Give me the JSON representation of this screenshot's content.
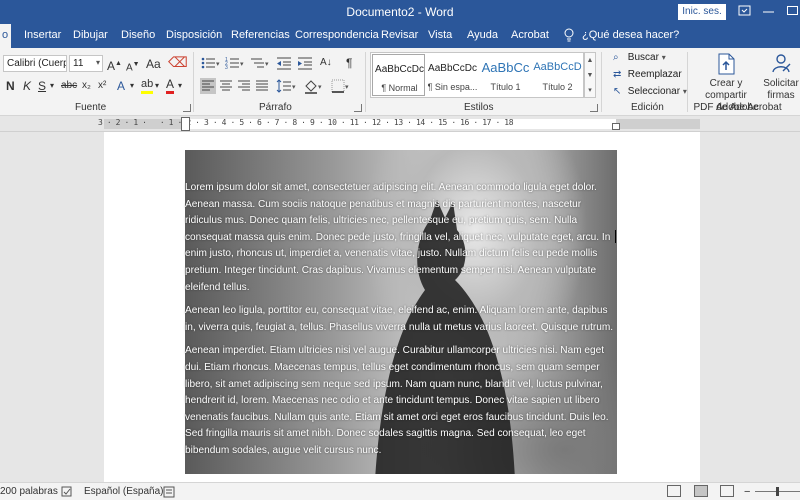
{
  "window": {
    "title": "Documento2 - Word",
    "signin_label": "Inic. ses."
  },
  "tabs": [
    {
      "label": "o",
      "active": true
    },
    {
      "label": "Insertar"
    },
    {
      "label": "Dibujar"
    },
    {
      "label": "Diseño"
    },
    {
      "label": "Disposición"
    },
    {
      "label": "Referencias"
    },
    {
      "label": "Correspondencia"
    },
    {
      "label": "Revisar"
    },
    {
      "label": "Vista"
    },
    {
      "label": "Ayuda"
    },
    {
      "label": "Acrobat"
    }
  ],
  "tellme": {
    "label": "¿Qué desea hacer?"
  },
  "ribbon": {
    "font": {
      "group_label": "Fuente",
      "font_name": "Calibri (Cuerpo",
      "font_size": "11",
      "grow_label": "A",
      "shrink_label": "A",
      "case_label": "Aa",
      "bold": "N",
      "italic": "K",
      "underline": "S",
      "strike": "abc",
      "subscript": "x₂",
      "superscript": "x²",
      "effects": "A",
      "highlight": "ab",
      "fontcolor": "A"
    },
    "paragraph": {
      "group_label": "Párrafo",
      "pilcrow": "¶"
    },
    "styles": {
      "group_label": "Estilos",
      "items": [
        {
          "preview": "AaBbCcDc",
          "name": "¶ Normal"
        },
        {
          "preview": "AaBbCcDc",
          "name": "¶ Sin espa..."
        },
        {
          "preview": "AaBbCc",
          "name": "Título 1"
        },
        {
          "preview": "AaBbCcD",
          "name": "Título 2"
        }
      ]
    },
    "editing": {
      "group_label": "Edición",
      "find": "Buscar",
      "replace": "Reemplazar",
      "select": "Seleccionar"
    },
    "acrobat": {
      "group_label": "Adobe Acrobat",
      "create_pdf_line1": "Crear y compartir",
      "create_pdf_line2": "PDF de Adobe",
      "request_sign_line1": "Solicitar",
      "request_sign_line2": "firmas"
    }
  },
  "ruler": {
    "numbers": "3 · 2 · 1 ·   · 1 · 2 · 3 · 4 · 5 · 6 · 7 · 8 · 9 · 10 · 11 · 12 · 13 · 14 · 15 · 16 · 17 · 18"
  },
  "document": {
    "paragraphs": [
      "Lorem ipsum dolor sit amet, consectetuer adipiscing elit. Aenean commodo ligula eget dolor. Aenean massa. Cum sociis natoque penatibus et magnis dis parturient montes, nascetur ridiculus mus. Donec quam felis, ultricies nec, pellentesque eu, pretium quis, sem. Nulla consequat massa quis enim. Donec pede justo, fringilla vel, aliquet nec, vulputate eget, arcu. In enim justo, rhoncus ut, imperdiet a, venenatis vitae, justo. Nullam dictum felis eu pede mollis pretium. Integer tincidunt. Cras dapibus. Vivamus elementum semper nisi. Aenean vulputate eleifend tellus.",
      "Aenean leo ligula, porttitor eu, consequat vitae, eleifend ac, enim. Aliquam lorem ante, dapibus in, viverra quis, feugiat a, tellus. Phasellus viverra nulla ut metus varius laoreet. Quisque rutrum.",
      "Aenean imperdiet. Etiam ultricies nisi vel augue. Curabitur ullamcorper ultricies nisi. Nam eget dui. Etiam rhoncus. Maecenas tempus, tellus eget condimentum rhoncus, sem quam semper libero, sit amet adipiscing sem neque sed ipsum. Nam quam nunc, blandit vel, luctus pulvinar, hendrerit id, lorem. Maecenas nec odio et ante tincidunt tempus. Donec vitae sapien ut libero venenatis faucibus. Nullam quis ante. Etiam sit amet orci eget eros faucibus tincidunt. Duis leo. Sed fringilla mauris sit amet nibh. Donec sodales sagittis magna. Sed consequat, leo eget bibendum sodales, augue velit cursus nunc."
    ]
  },
  "status": {
    "words": "200 palabras",
    "language": "Español (España)"
  }
}
